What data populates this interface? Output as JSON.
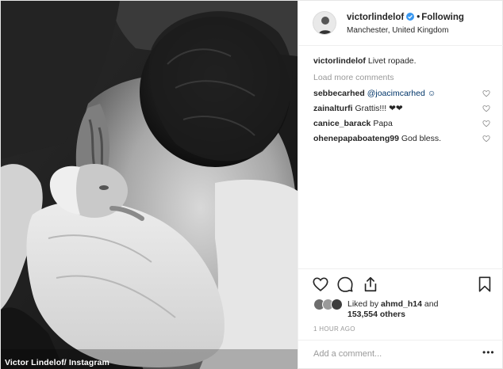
{
  "photo": {
    "credit": "Victor Lindelof/ Instagram"
  },
  "header": {
    "username": "victorlindelof",
    "separator": "•",
    "follow_label": "Following",
    "location": "Manchester, United Kingdom"
  },
  "caption": {
    "username": "victorlindelof",
    "text": "Livet ropade."
  },
  "load_more_label": "Load more comments",
  "comments": [
    {
      "username": "sebbecarhed",
      "text": "@joacimcarhed ☺"
    },
    {
      "username": "zainalturfi",
      "text": "Grattis!!! ❤❤"
    },
    {
      "username": "canice_barack",
      "text": "Papa"
    },
    {
      "username": "ohenepapaboateng99",
      "text": "God bless."
    }
  ],
  "likes": {
    "prefix": "Liked by",
    "user": "ahmd_h14",
    "conj": "and",
    "count": "153,554 others"
  },
  "timestamp": "1 HOUR AGO",
  "add_comment_placeholder": "Add a comment...",
  "more_label": "•••",
  "icons": [
    "heart-icon",
    "comment-icon",
    "share-icon",
    "bookmark-icon",
    "verified-badge-icon"
  ]
}
